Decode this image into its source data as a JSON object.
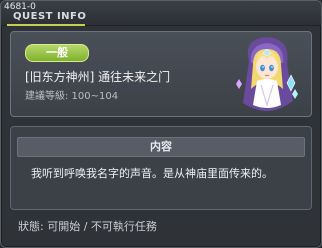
{
  "window": {
    "quest_id": "4681-0",
    "title": "QUEST INFO"
  },
  "quest": {
    "category_badge": "一般",
    "name": "[旧东方神州] 通往未来之门",
    "recommended_level": "建議等級: 100~104",
    "npc_portrait": "npc-portrait-icon"
  },
  "content": {
    "header": "内容",
    "text": "我听到呼唤我名字的声音。是从神庙里面传来的。"
  },
  "status": "狀態: 可開始 / 不可執行任務",
  "colors": {
    "badge_green": "#8fc03c",
    "title_underline": "#c8cc54",
    "panel_bg": "#3c4148"
  }
}
